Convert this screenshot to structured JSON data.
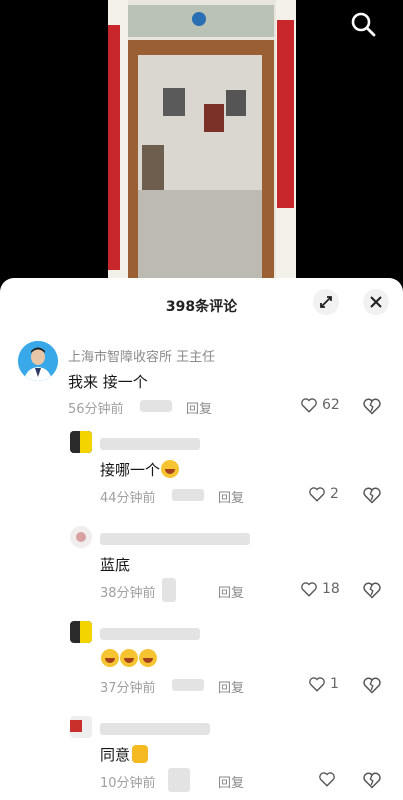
{
  "video": {
    "scene": "doorway interior with red couplets",
    "search_icon": "search-icon"
  },
  "panel": {
    "title": "398条评论",
    "expand_icon": "expand-icon",
    "close_icon": "close-icon"
  },
  "comments": [
    {
      "name": "上海市智障收容所 王主任",
      "text": "我来 接一个",
      "time": "56分钟前",
      "reply": "回复",
      "likes": "62"
    },
    {
      "name": "",
      "text": "接哪一个",
      "time": "44分钟前",
      "reply": "回复",
      "likes": "2"
    },
    {
      "name": "",
      "text": "蓝底",
      "time": "38分钟前",
      "reply": "回复",
      "likes": "18"
    },
    {
      "name": "",
      "text": "",
      "time": "37分钟前",
      "reply": "回复",
      "likes": "1"
    },
    {
      "name": "",
      "text": "同意",
      "time": "10分钟前",
      "reply": "回复",
      "likes": ""
    }
  ]
}
